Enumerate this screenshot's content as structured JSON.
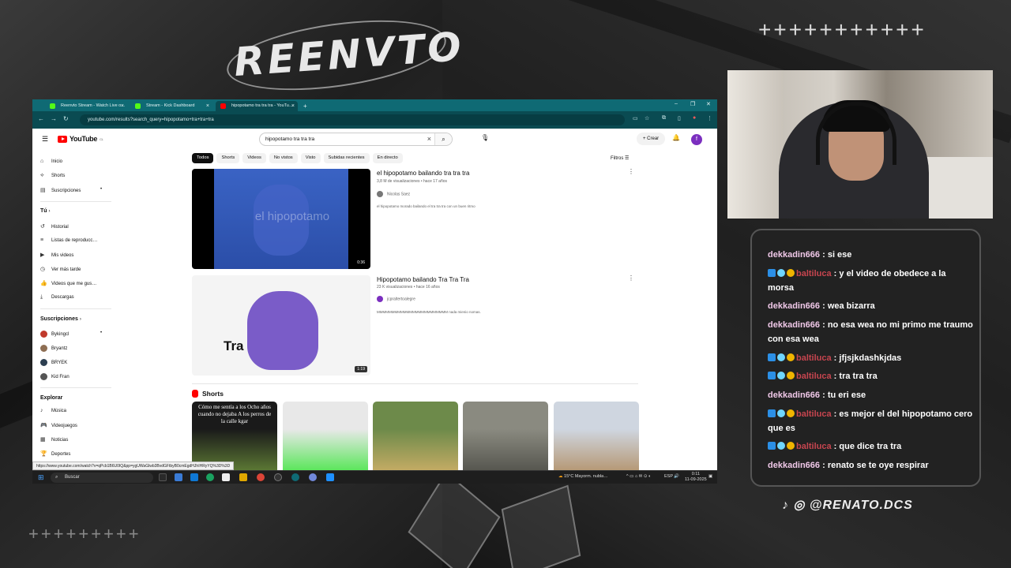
{
  "overlay": {
    "brand": "REENVTO",
    "plus_top": "+++++++++++",
    "plus_bottom": "+++++++++",
    "social_handle": "@RENATO.DCS"
  },
  "browser": {
    "tabs": [
      {
        "label": "Reenvto Stream - Watch Live o…",
        "color": "#53fc18"
      },
      {
        "label": "Stream - Kick Dashboard",
        "color": "#53fc18"
      },
      {
        "label": "hipopotamo tra tra tra - YouTu…",
        "color": "#ff0000"
      }
    ],
    "new_tab": "+",
    "url": "youtube.com/results?search_query=hipopotamo+tra+tra+tra",
    "status_url": "https://www.youtube.com/watch?v=qPcb1B6U0IQ&pp=ygUWaGlwb3BvdGFtbyB0cmEgdHJhIHRyYQ%3D%3D"
  },
  "youtube": {
    "logo": "YouTube",
    "logo_region": "CL",
    "search_value": "hipopotamo tra tra tra",
    "create_label": "Crear",
    "avatar_letter": "f",
    "sidebar": {
      "main": [
        "Inicio",
        "Shorts",
        "Suscripciones"
      ],
      "you_header": "Tú",
      "you": [
        "Historial",
        "Listas de reproducc…",
        "Mis videos",
        "Ver más tarde",
        "Videos que me gus…",
        "Descargas"
      ],
      "subs_header": "Suscripciones",
      "subs": [
        {
          "name": "Bykingcl",
          "color": "#c0392b"
        },
        {
          "name": "Bryantz",
          "color": "#8e6e53"
        },
        {
          "name": "BRYEK",
          "color": "#2c3e50"
        },
        {
          "name": "Kid Fran",
          "color": "#555555"
        }
      ],
      "explore_header": "Explorar",
      "explore": [
        "Música",
        "Videojuegos",
        "Noticias",
        "Deportes"
      ]
    },
    "chips": [
      "Todos",
      "Shorts",
      "Videos",
      "No vistos",
      "Visto",
      "Subidas recientes",
      "En directo"
    ],
    "filters_label": "Filtros",
    "videos": [
      {
        "title": "el hipopotamo bailando tra tra tra",
        "meta": "3,8 M de visualizaciones • hace 17 años",
        "channel": "Nicolas Saez",
        "desc": "el hipopotamo morado bailando el tra tra tra con un buen ritmo",
        "duration": "0:36",
        "overlay_text": "el hipopotamo"
      },
      {
        "title": "Hipopotamo bailando Tra Tra Tra",
        "meta": "23 K visualizaciones • hace 16 años",
        "channel": "jcpraltertoalegre",
        "desc": "MMMMMMMMMMMMMMMMMMMMMMMM nada mienio nomas.",
        "duration": "1:19",
        "overlay_text": "Tra"
      }
    ],
    "shorts_header": "Shorts",
    "shorts": [
      {
        "caption": "Cómo me sentía a los Ocho años cuando no dejaba A los perros de la calle kgar",
        "colors": [
          "#1a1a1a",
          "#6b8e3a"
        ]
      },
      {
        "caption": "",
        "colors": [
          "#e8e8e8",
          "#39e639"
        ]
      },
      {
        "caption": "",
        "colors": [
          "#6d8a4a",
          "#d8b36a"
        ]
      },
      {
        "caption": "",
        "colors": [
          "#8a8a80",
          "#4a4a44"
        ]
      },
      {
        "caption": "",
        "colors": [
          "#cfd6e0",
          "#b08a5c"
        ]
      }
    ]
  },
  "taskbar": {
    "search_placeholder": "Buscar",
    "weather": "15°C  Mayorm. nubla…",
    "lang": "ESP",
    "time": "0:11",
    "date": "11-09-2025"
  },
  "chat": {
    "messages": [
      {
        "user": "dekkadin666",
        "text": "si ese",
        "badges": false
      },
      {
        "user": "baltiluca",
        "text": "y el video de obedece a la morsa",
        "badges": true
      },
      {
        "user": "dekkadin666",
        "text": "wea bizarra",
        "badges": false
      },
      {
        "user": "dekkadin666",
        "text": "no esa wea no mi primo me traumo con esa wea",
        "badges": false
      },
      {
        "user": "baltiluca",
        "text": "jfjsjkdashkjdas",
        "badges": true
      },
      {
        "user": "baltiluca",
        "text": "tra tra tra",
        "badges": true
      },
      {
        "user": "dekkadin666",
        "text": "tu eri ese",
        "badges": false
      },
      {
        "user": "baltiluca",
        "text": "es mejor el del hipopotamo cero que es",
        "badges": true
      },
      {
        "user": "baltiluca",
        "text": "que dice tra tra",
        "badges": true
      },
      {
        "user": "dekkadin666",
        "text": "renato se te oye respirar",
        "badges": false
      }
    ]
  }
}
